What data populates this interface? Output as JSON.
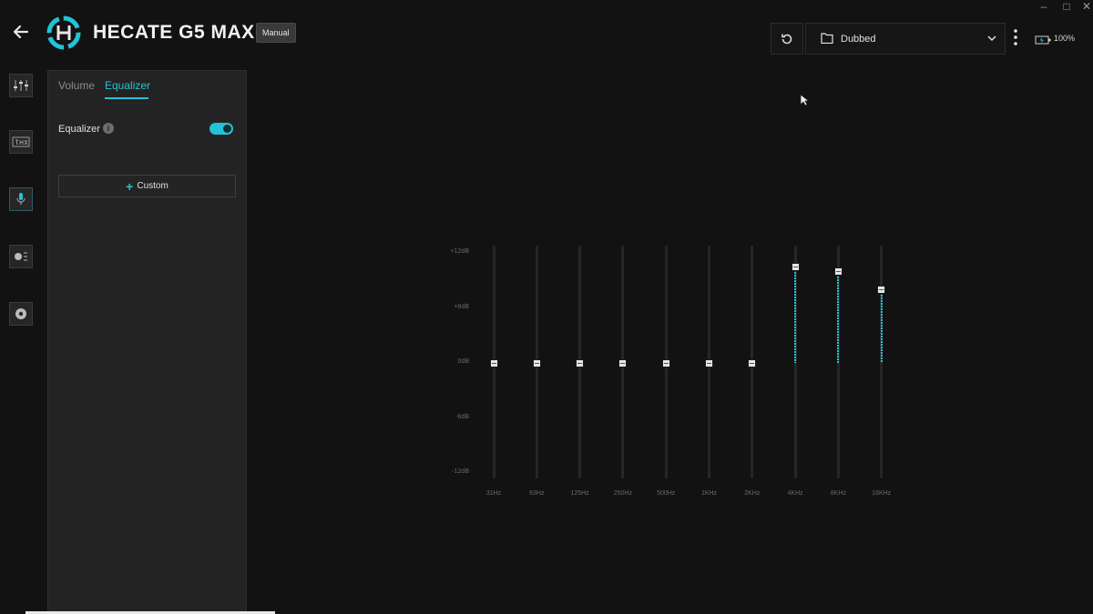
{
  "header": {
    "app_title": "HECATE G5 MAX",
    "mode_badge": "Manual",
    "preset": {
      "selected": "Dubbed"
    },
    "battery": "100%"
  },
  "rail": {
    "items": [
      {
        "id": "sliders",
        "icon": "sliders-icon"
      },
      {
        "id": "thx",
        "icon": "surround-icon"
      },
      {
        "id": "mic",
        "icon": "microphone-icon"
      },
      {
        "id": "lighting",
        "icon": "lighting-icon"
      },
      {
        "id": "settings",
        "icon": "settings-icon"
      }
    ]
  },
  "panel": {
    "tabs": [
      {
        "label": "Volume",
        "active": false
      },
      {
        "label": "Equalizer",
        "active": true
      }
    ],
    "equalizer_label": "Equalizer",
    "equalizer_enabled": true,
    "custom_button": "Custom"
  },
  "equalizer": {
    "db_labels": [
      "+12dB",
      "+6dB",
      "0dB",
      "-6dB",
      "-12dB"
    ],
    "range": [
      -12,
      12
    ],
    "bands": [
      {
        "freq": "31Hz",
        "gain": 0
      },
      {
        "freq": "63Hz",
        "gain": 0
      },
      {
        "freq": "125Hz",
        "gain": 0
      },
      {
        "freq": "250Hz",
        "gain": 0
      },
      {
        "freq": "500Hz",
        "gain": 0
      },
      {
        "freq": "1KHz",
        "gain": 0
      },
      {
        "freq": "2KHz",
        "gain": 0
      },
      {
        "freq": "4KHz",
        "gain": 10.5
      },
      {
        "freq": "8KHz",
        "gain": 10
      },
      {
        "freq": "16KHz",
        "gain": 8
      }
    ],
    "accent": "#22c3d8"
  }
}
